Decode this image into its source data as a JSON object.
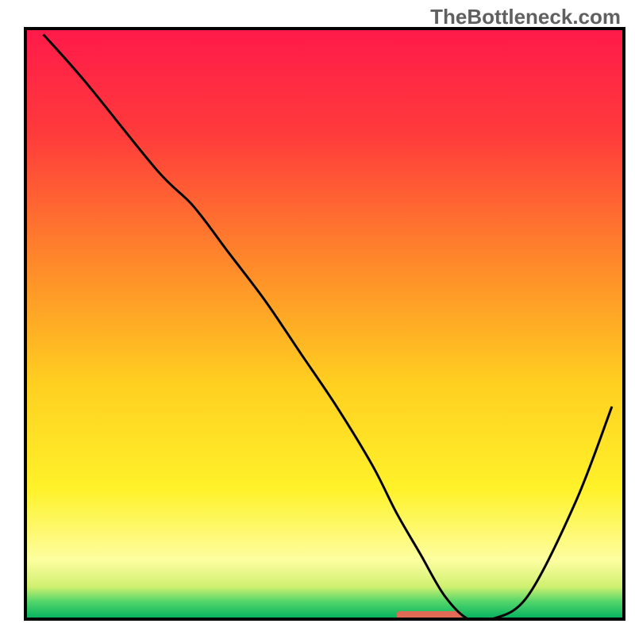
{
  "watermark": "TheBottleneck.com",
  "chart_data": {
    "type": "line",
    "title": "",
    "xlabel": "",
    "ylabel": "",
    "xlim": [
      0,
      100
    ],
    "ylim": [
      0,
      100
    ],
    "x": [
      3,
      10,
      22,
      28,
      34,
      40,
      46,
      52,
      58,
      62,
      66,
      70,
      74,
      78,
      84,
      92,
      98
    ],
    "values": [
      99,
      91,
      76,
      70,
      62,
      54,
      45,
      36,
      26,
      18,
      11,
      4,
      0,
      0,
      4,
      20,
      36
    ],
    "marker": {
      "x_start": 62,
      "x_end": 73,
      "y": 0
    },
    "gradient": {
      "stops": [
        {
          "pos": 0.0,
          "color": "#ff1a4a"
        },
        {
          "pos": 0.18,
          "color": "#ff3b3b"
        },
        {
          "pos": 0.4,
          "color": "#ff8a2a"
        },
        {
          "pos": 0.6,
          "color": "#ffcf20"
        },
        {
          "pos": 0.78,
          "color": "#fff22a"
        },
        {
          "pos": 0.9,
          "color": "#fdfea0"
        },
        {
          "pos": 0.945,
          "color": "#d0f070"
        },
        {
          "pos": 0.97,
          "color": "#54d66a"
        },
        {
          "pos": 1.0,
          "color": "#00b060"
        }
      ]
    },
    "frame": {
      "stroke": "#000000",
      "width": 4
    }
  }
}
